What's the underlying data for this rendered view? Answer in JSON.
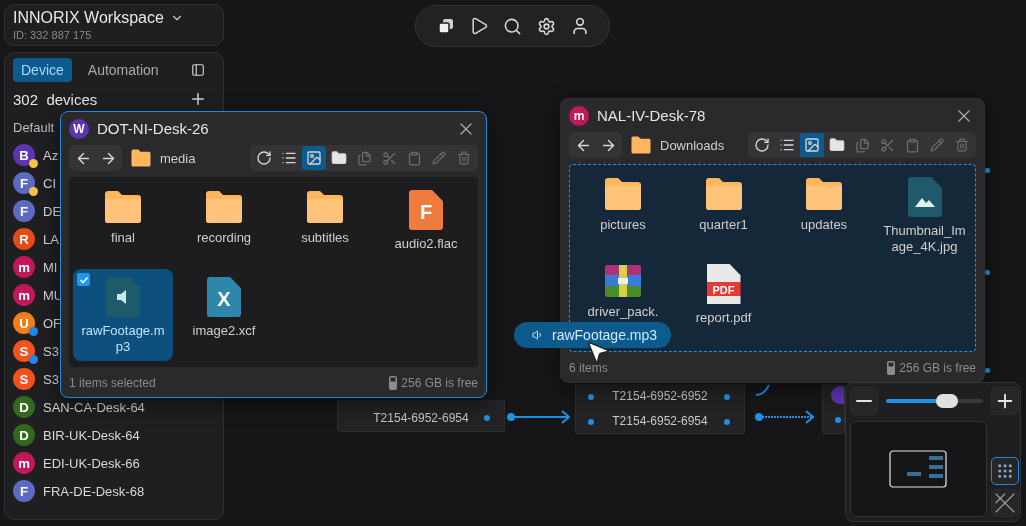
{
  "workspace": {
    "name": "INNORIX Workspace",
    "id": "ID: 332 887 175"
  },
  "sidebar": {
    "tabs": [
      {
        "label": "Device",
        "selected": true
      },
      {
        "label": "Automation",
        "selected": false
      }
    ],
    "count": "302",
    "count_label": "devices",
    "group": "Default",
    "devices": [
      {
        "initial": "B",
        "name": "Az",
        "color": "#5e35b1",
        "status": {
          "color": "#f5c542"
        }
      },
      {
        "initial": "F",
        "name": "CI",
        "color": "#5c6bc0",
        "status": {
          "color": "#f5c542"
        }
      },
      {
        "initial": "F",
        "name": "DE",
        "color": "#5c6bc0"
      },
      {
        "initial": "R",
        "name": "LA",
        "color": "#e64a19"
      },
      {
        "initial": "m",
        "name": "MI",
        "color": "#c2185b"
      },
      {
        "initial": "m",
        "name": "MU",
        "color": "#c2185b"
      },
      {
        "initial": "U",
        "name": "OF",
        "color": "#ef7f1a",
        "status": {
          "color": "#1e88e5"
        }
      },
      {
        "initial": "S",
        "name": "S3",
        "color": "#f4511e",
        "status": {
          "color": "#1e88e5"
        }
      },
      {
        "initial": "S",
        "name": "S3",
        "color": "#f4511e"
      },
      {
        "initial": "D",
        "name": "SAN-CA-Desk-64",
        "color": "#33691e"
      },
      {
        "initial": "D",
        "name": "BIR-UK-Desk-64",
        "color": "#33691e"
      },
      {
        "initial": "m",
        "name": "EDI-UK-Desk-66",
        "color": "#c2185b"
      },
      {
        "initial": "F",
        "name": "FRA-DE-Desk-68",
        "color": "#5c6bc0"
      }
    ]
  },
  "nodes": [
    {
      "rows": [
        "T2154-6952-6954"
      ]
    },
    {
      "rows": [
        "T2154-6952-6952",
        "T2154-6952-6954"
      ]
    },
    {
      "avatar": {
        "color": "#5e35b1"
      }
    }
  ],
  "windows": [
    {
      "avatar": {
        "initial": "W",
        "color": "#5e35b1"
      },
      "title": "DOT-NI-Desk-26",
      "path": "media",
      "focused": true,
      "drop_target": false,
      "views": [
        {
          "kind": "list",
          "selected": false
        },
        {
          "kind": "grid",
          "selected": true
        }
      ],
      "files": [
        {
          "name": "final",
          "kind": "folder",
          "selected": false
        },
        {
          "name": "recording",
          "kind": "folder",
          "selected": false
        },
        {
          "name": "subtitles",
          "kind": "folder",
          "selected": false
        },
        {
          "name": "audio2.flac",
          "kind": "letter",
          "letter": "F",
          "color": "#f07b3f",
          "selected": false
        },
        {
          "name": "rawFootage.mp3",
          "kind": "audio",
          "selected": true
        },
        {
          "name": "image2.xcf",
          "kind": "letter",
          "letter": "X",
          "color": "#2e86ab",
          "selected": false
        }
      ],
      "status": "1 items selected",
      "free": "256 GB is free"
    },
    {
      "avatar": {
        "initial": "m",
        "color": "#c2185b"
      },
      "title": "NAL-IV-Desk-78",
      "path": "Downloads",
      "focused": false,
      "drop_target": true,
      "views": [
        {
          "kind": "list",
          "selected": false
        },
        {
          "kind": "grid",
          "selected": true
        }
      ],
      "files": [
        {
          "name": "pictures",
          "kind": "folder",
          "selected": false
        },
        {
          "name": "quarter1",
          "kind": "folder",
          "selected": false
        },
        {
          "name": "updates",
          "kind": "folder",
          "selected": false
        },
        {
          "name": "Thumbnail_Image_4K.jpg",
          "kind": "image",
          "selected": false
        },
        {
          "name": "driver_pack.",
          "kind": "archive",
          "selected": false
        },
        {
          "name": "report.pdf",
          "kind": "pdf",
          "badge": "PDF",
          "selected": false
        }
      ],
      "status": "6 items",
      "free": "256 GB is free"
    }
  ],
  "drag": {
    "label": "rawFootage.mp3"
  },
  "zoom": {
    "level": 0.63,
    "snap": true
  }
}
